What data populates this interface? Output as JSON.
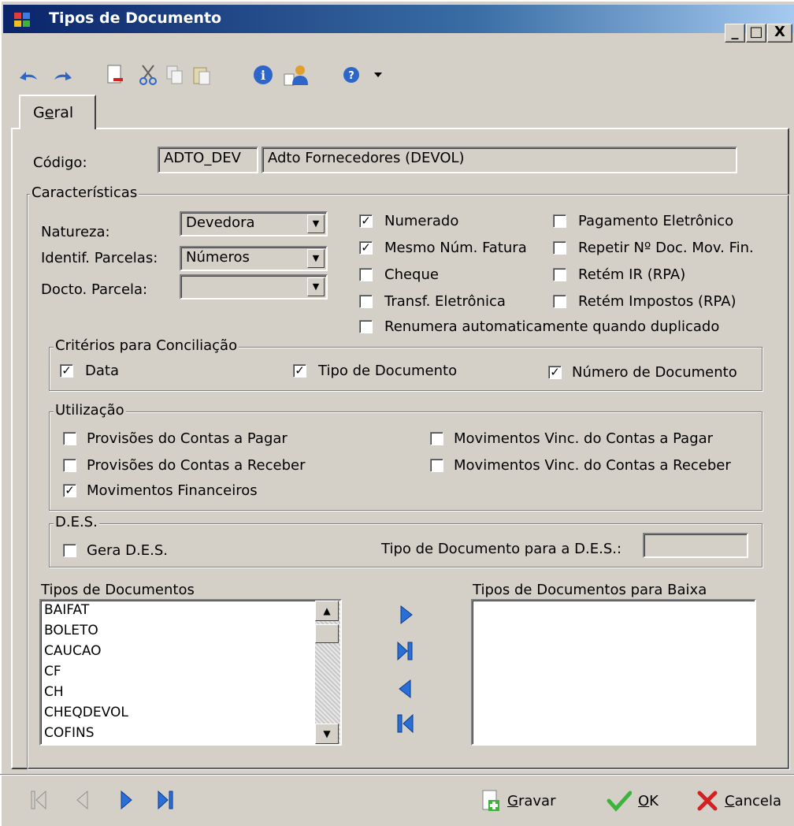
{
  "window": {
    "title": "Tipos de Documento",
    "min_glyph": "_",
    "max_glyph": "□",
    "close_glyph": "X"
  },
  "toolbar": {
    "icons": [
      "undo-icon",
      "redo-icon",
      "new-document-icon",
      "cut-icon",
      "copy-icon",
      "paste-icon",
      "info-icon",
      "user-icon",
      "help-icon",
      "dropdown-arrow-icon"
    ]
  },
  "tabs": [
    {
      "label_pre": "G",
      "label_ul": "e",
      "label_post": "ral"
    }
  ],
  "codigo": {
    "label": "Código:",
    "code": "ADTO_DEV",
    "description": "Adto Fornecedores (DEVOL)"
  },
  "caracteristicas": {
    "title": "Características",
    "natureza": {
      "label": "Natureza:",
      "value": "Devedora"
    },
    "identif": {
      "label": "Identif. Parcelas:",
      "value": "Números"
    },
    "docto": {
      "label": "Docto. Parcela:",
      "value": ""
    },
    "checks_col1": [
      {
        "label": "Numerado",
        "checked": true
      },
      {
        "label": "Mesmo Núm. Fatura",
        "checked": true
      },
      {
        "label": "Cheque",
        "checked": false
      },
      {
        "label": "Transf. Eletrônica",
        "checked": false
      }
    ],
    "checks_col2": [
      {
        "label": "Pagamento Eletrônico",
        "checked": false
      },
      {
        "label": "Repetir Nº Doc. Mov. Fin.",
        "checked": false
      },
      {
        "label": "Retém IR (RPA)",
        "checked": false
      },
      {
        "label": "Retém Impostos (RPA)",
        "checked": false
      }
    ],
    "renumera": {
      "label": "Renumera automaticamente quando duplicado",
      "checked": false
    }
  },
  "conciliacao": {
    "title": "Critérios para Conciliação",
    "items": [
      {
        "label": "Data",
        "checked": true
      },
      {
        "label": "Tipo de Documento",
        "checked": true
      },
      {
        "label": "Número de Documento",
        "checked": true
      }
    ]
  },
  "utilizacao": {
    "title": "Utilização",
    "items": [
      {
        "label": "Provisões do Contas a Pagar",
        "checked": false
      },
      {
        "label": "Provisões do Contas a Receber",
        "checked": false
      },
      {
        "label": "Movimentos Financeiros",
        "checked": true
      },
      {
        "label": "Movimentos Vinc. do Contas a Pagar",
        "checked": false
      },
      {
        "label": "Movimentos Vinc. do Contas a Receber",
        "checked": false
      }
    ]
  },
  "des": {
    "title": "D.E.S.",
    "gera": {
      "label": "Gera D.E.S.",
      "checked": false
    },
    "tipo_label": "Tipo de Documento para a D.E.S.:",
    "tipo_value": ""
  },
  "lists": {
    "left_title": "Tipos de Documentos",
    "right_title": "Tipos de Documentos para Baixa",
    "left_items": [
      "BAIFAT",
      "BOLETO",
      "CAUCAO",
      "CF",
      "CH",
      "CHEQDEVOL",
      "COFINS"
    ],
    "right_items": []
  },
  "footer": {
    "gravar": {
      "ul": "G",
      "rest": "ravar"
    },
    "ok": {
      "ul": "O",
      "rest": "K"
    },
    "cancela": {
      "ul": "C",
      "rest": "ancela"
    }
  },
  "colors": {
    "title_start": "#0a246a",
    "title_end": "#a6caf0",
    "nav_blue": "#2a6fd6",
    "ok_green": "#3cb43c",
    "cancel_red": "#d42020"
  }
}
